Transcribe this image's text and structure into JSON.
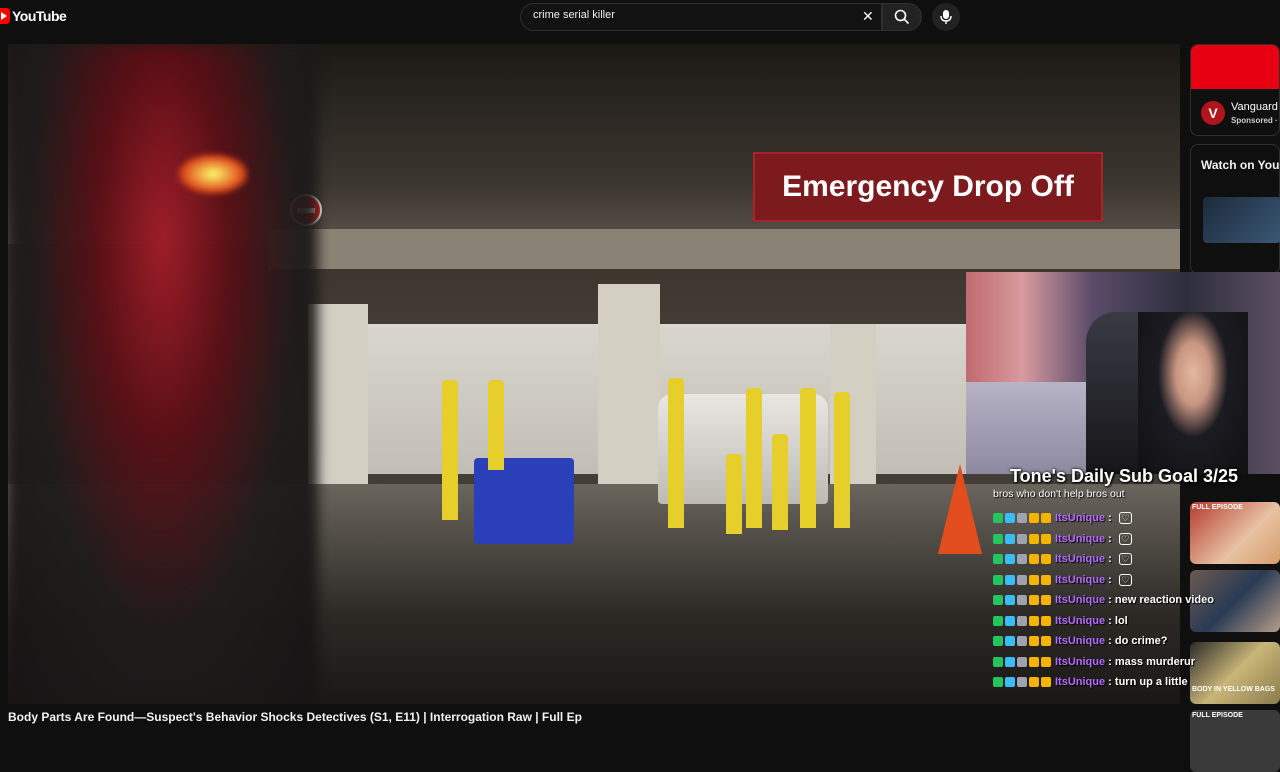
{
  "header": {
    "logo_text": "YouTube",
    "search_value": "crime serial killer",
    "clear_icon": "close-icon",
    "search_icon": "search-icon",
    "mic_icon": "mic-icon"
  },
  "video": {
    "sign_text": "Emergency Drop Off",
    "title": "Body Parts Are Found—Suspect's Behavior Shocks Detectives (S1, E11) | Interrogation Raw | Full Ep"
  },
  "sidebar": {
    "ad": {
      "logo_letter": "V",
      "name": "Vanguard",
      "sponsored": "Sponsored ·"
    },
    "watch_title": "Watch on You",
    "thumbs": [
      {
        "label": "FULL EPISODE"
      },
      {
        "label": ""
      },
      {
        "label": "BODY IN YELLOW BAGS"
      },
      {
        "label": "FULL EPISODE"
      }
    ]
  },
  "overlay": {
    "goal": "Tone's Daily Sub Goal 3/25",
    "subtitle": "bros who don't help bros out",
    "chat": [
      {
        "user": "ItsUnique",
        "msg": "",
        "heart": true
      },
      {
        "user": "ItsUnique",
        "msg": "",
        "heart": true
      },
      {
        "user": "ItsUnique",
        "msg": "",
        "heart": true
      },
      {
        "user": "ItsUnique",
        "msg": "",
        "heart": true
      },
      {
        "user": "ItsUnique",
        "msg": "new reaction video",
        "heart": false
      },
      {
        "user": "ItsUnique",
        "msg": "lol",
        "heart": false
      },
      {
        "user": "ItsUnique",
        "msg": "do crime?",
        "heart": false
      },
      {
        "user": "ItsUnique",
        "msg": "mass murderur",
        "heart": false
      },
      {
        "user": "ItsUnique",
        "msg": "turn up a little",
        "heart": false
      }
    ],
    "badge_colors": [
      "#22c55e",
      "#38bdf8",
      "#9ca3af",
      "#f5b400",
      "#f5b400"
    ]
  }
}
